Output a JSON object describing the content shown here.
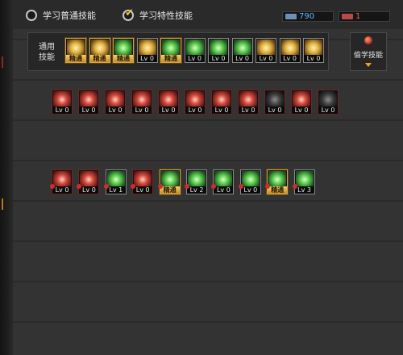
{
  "tabs": [
    {
      "label": "学习普通技能",
      "selected": false
    },
    {
      "label": "学习特性技能",
      "selected": true
    }
  ],
  "resources": {
    "points_blue": "790",
    "points_red": "1"
  },
  "general_panel": {
    "label_line1": "通用",
    "label_line2": "技能"
  },
  "other_skills_button": {
    "label": "偷学技能"
  },
  "general_skills": [
    {
      "level": "精通",
      "art": "goldart",
      "frame": "gold"
    },
    {
      "level": "精通",
      "art": "goldart",
      "frame": "gold"
    },
    {
      "level": "精通",
      "art": "green",
      "frame": "gold"
    },
    {
      "level": "Lv 0",
      "art": "goldart",
      "frame": "plain"
    },
    {
      "level": "精通",
      "art": "green",
      "frame": "gold"
    },
    {
      "level": "Lv 0",
      "art": "green",
      "frame": "plain"
    },
    {
      "level": "Lv 0",
      "art": "green",
      "frame": "plain"
    },
    {
      "level": "Lv 0",
      "art": "green",
      "frame": "plain"
    },
    {
      "level": "Lv 0",
      "art": "goldart",
      "frame": "plain"
    },
    {
      "level": "Lv 0",
      "art": "goldart",
      "frame": "plain"
    },
    {
      "level": "Lv 0",
      "art": "goldart",
      "frame": "plain"
    }
  ],
  "row1_skills": [
    {
      "level": "Lv 0",
      "art": "crimson"
    },
    {
      "level": "Lv 0",
      "art": "crimson"
    },
    {
      "level": "Lv 0",
      "art": "crimson"
    },
    {
      "level": "Lv 0",
      "art": "crimson"
    },
    {
      "level": "Lv 0",
      "art": "crimson"
    },
    {
      "level": "Lv 0",
      "art": "crimson"
    },
    {
      "level": "Lv 0",
      "art": "crimson"
    },
    {
      "level": "Lv 0",
      "art": "crimson"
    },
    {
      "level": "Lv 0",
      "art": "dark"
    },
    {
      "level": "Lv 0",
      "art": "crimson"
    },
    {
      "level": "Lv 0",
      "art": "dark"
    }
  ],
  "row2_skills": [
    {
      "level": "Lv 0",
      "art": "crimson",
      "frame": "red"
    },
    {
      "level": "Lv 0",
      "art": "crimson",
      "frame": "red"
    },
    {
      "level": "Lv 1",
      "art": "green",
      "frame": "plain"
    },
    {
      "level": "Lv 0",
      "art": "crimson",
      "frame": "red"
    },
    {
      "level": "精通",
      "art": "green",
      "frame": "gold"
    },
    {
      "level": "Lv 2",
      "art": "green",
      "frame": "plain"
    },
    {
      "level": "Lv 0",
      "art": "green",
      "frame": "plain"
    },
    {
      "level": "Lv 0",
      "art": "green",
      "frame": "plain"
    },
    {
      "level": "精通",
      "art": "green",
      "frame": "gold"
    },
    {
      "level": "Lv 3",
      "art": "green",
      "frame": "plain"
    }
  ],
  "colors": {
    "background": "#2f2f2f",
    "blue_value": "#5db7ff",
    "red_value": "#ff5a4c",
    "mastery_gold": "#d8a640",
    "radio_blue": "#3da0e6",
    "check_gold": "#f3c232"
  }
}
